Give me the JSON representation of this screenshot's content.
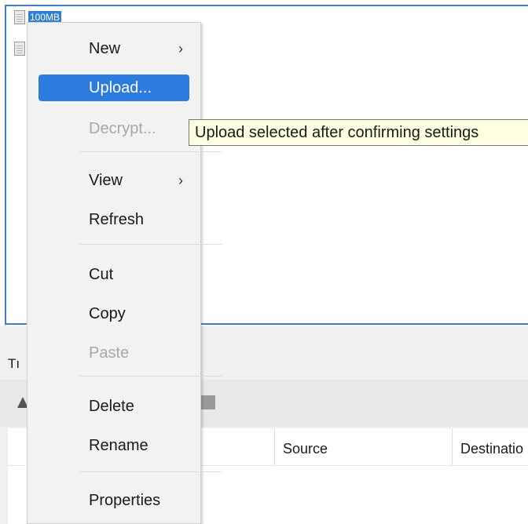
{
  "files": [
    {
      "name": "100MB",
      "selected": true
    },
    {
      "name": "",
      "selected": false
    }
  ],
  "transfers": {
    "tab_label": "Tı",
    "columns": [
      "",
      "Source",
      "Destinatio"
    ]
  },
  "context_menu": {
    "items": [
      {
        "label": "New",
        "submenu": true,
        "enabled": true
      },
      {
        "label": "Upload...",
        "submenu": false,
        "enabled": true,
        "highlighted": true
      },
      {
        "label": "Decrypt...",
        "submenu": false,
        "enabled": false
      },
      {
        "label": "View",
        "submenu": true,
        "enabled": true
      },
      {
        "label": "Refresh",
        "submenu": false,
        "enabled": true
      },
      {
        "label": "Cut",
        "submenu": false,
        "enabled": true
      },
      {
        "label": "Copy",
        "submenu": false,
        "enabled": true
      },
      {
        "label": "Paste",
        "submenu": false,
        "enabled": false
      },
      {
        "label": "Delete",
        "submenu": false,
        "enabled": true
      },
      {
        "label": "Rename",
        "submenu": false,
        "enabled": true
      },
      {
        "label": "Properties",
        "submenu": false,
        "enabled": true
      }
    ],
    "chevron": "›"
  },
  "tooltip": {
    "text": "Upload selected after confirming settings"
  },
  "colors": {
    "selection": "#2c7be0",
    "pane_border": "#3d7fd6",
    "tooltip_bg": "#ffffe1",
    "disabled_text": "#a8a8a8"
  }
}
